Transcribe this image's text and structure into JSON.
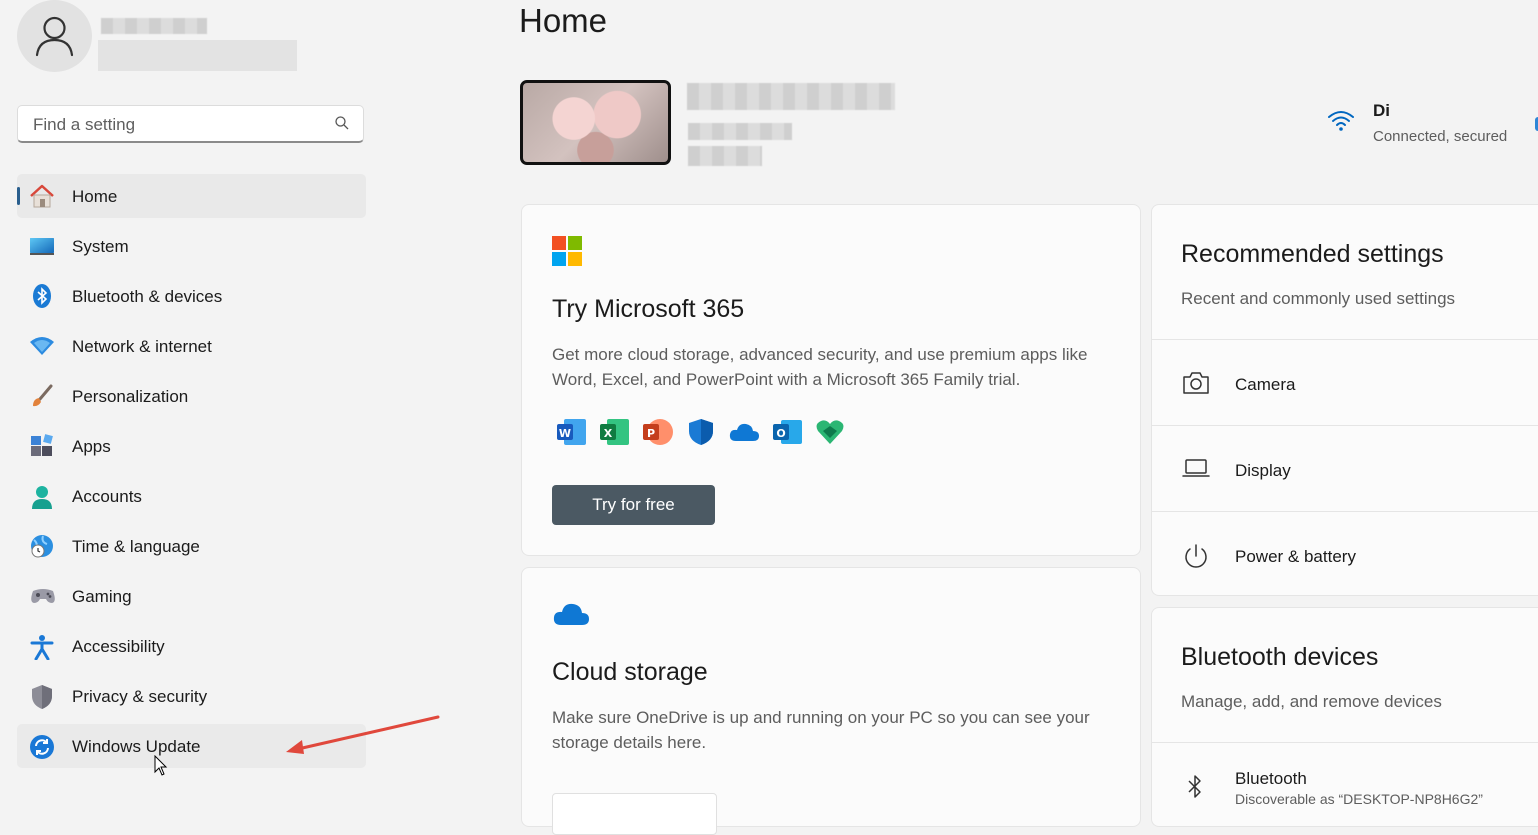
{
  "search": {
    "placeholder": "Find a setting"
  },
  "nav": [
    {
      "label": "Home"
    },
    {
      "label": "System"
    },
    {
      "label": "Bluetooth & devices"
    },
    {
      "label": "Network & internet"
    },
    {
      "label": "Personalization"
    },
    {
      "label": "Apps"
    },
    {
      "label": "Accounts"
    },
    {
      "label": "Time & language"
    },
    {
      "label": "Gaming"
    },
    {
      "label": "Accessibility"
    },
    {
      "label": "Privacy & security"
    },
    {
      "label": "Windows Update"
    }
  ],
  "page": {
    "title": "Home"
  },
  "network": {
    "name": "Di",
    "status": "Connected, secured"
  },
  "m365": {
    "title": "Try Microsoft 365",
    "description": "Get more cloud storage, advanced security, and use premium apps like Word, Excel, and PowerPoint with a Microsoft 365 Family trial.",
    "button": "Try for free",
    "apps": [
      "word-icon",
      "excel-icon",
      "powerpoint-icon",
      "defender-icon",
      "onedrive-icon",
      "outlook-icon",
      "family-icon"
    ]
  },
  "cloud": {
    "title": "Cloud storage",
    "description": "Make sure OneDrive is up and running on your PC so you can see your storage details here."
  },
  "recommended": {
    "title": "Recommended settings",
    "subtitle": "Recent and commonly used settings",
    "items": [
      {
        "label": "Camera",
        "icon": "camera-icon"
      },
      {
        "label": "Display",
        "icon": "display-icon"
      },
      {
        "label": "Power & battery",
        "icon": "power-icon"
      }
    ]
  },
  "bluetooth": {
    "title": "Bluetooth devices",
    "subtitle": "Manage, add, and remove devices",
    "item_label": "Bluetooth",
    "item_status": "Discoverable as “DESKTOP-NP8H6G2”"
  },
  "colors": {
    "accent": "#0067c0",
    "annotation_arrow": "#e0483c",
    "nav_selected_bar": "#2a5f8e"
  }
}
